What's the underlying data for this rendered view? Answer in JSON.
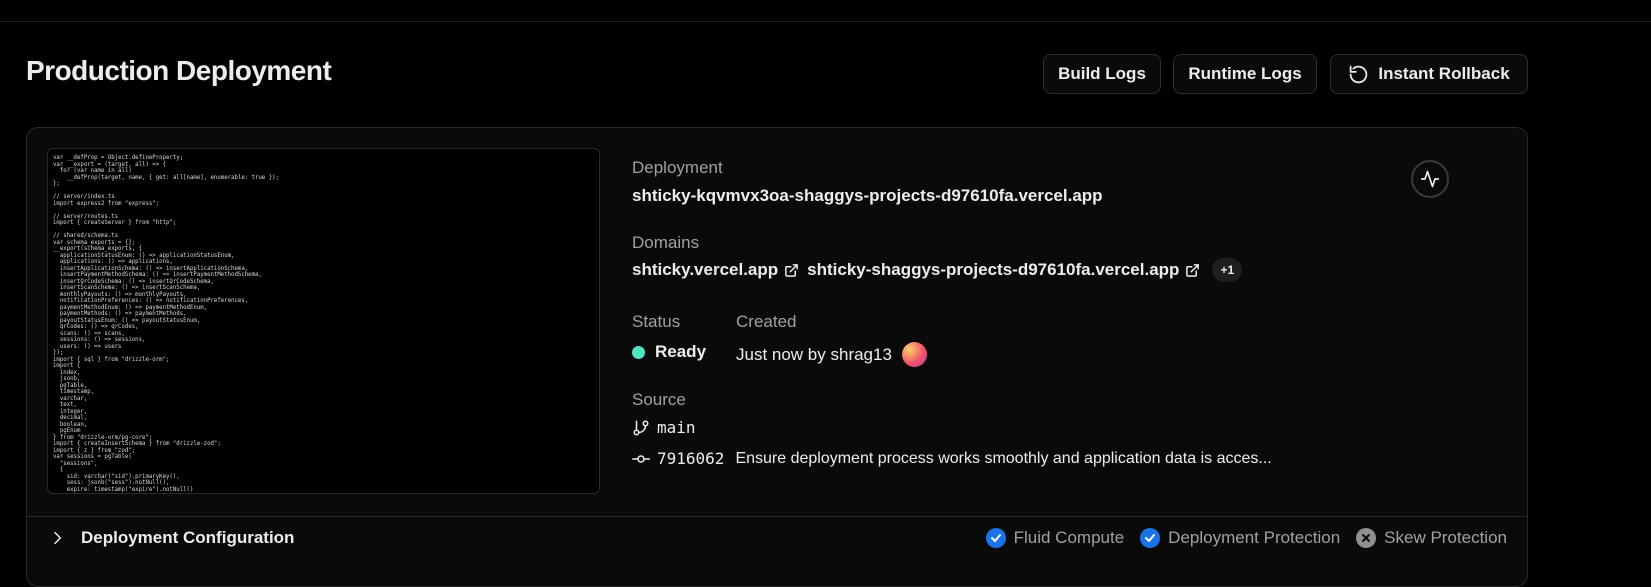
{
  "header": {
    "title": "Production Deployment",
    "buttons": {
      "build_logs": "Build Logs",
      "runtime_logs": "Runtime Logs",
      "instant_rollback": "Instant Rollback"
    }
  },
  "preview": {
    "code": "var __defProp = Object.defineProperty;\nvar __export = (target, all) => {\n  for (var name in all)\n    __defProp(target, name, { get: all[name], enumerable: true });\n};\n\n// server/index.ts\nimport express2 from \"express\";\n\n// server/routes.ts\nimport { createServer } from \"http\";\n\n// shared/schema.ts\nvar schema_exports = {};\n__export(schema_exports, {\n  applicationStatusEnum: () => applicationStatusEnum,\n  applications: () => applications,\n  insertApplicationSchema: () => insertApplicationSchema,\n  insertPaymentMethodSchema: () => insertPaymentMethodSchema,\n  insertQrCodeSchema: () => insertQrCodeSchema,\n  insertScanSchema: () => insertScanSchema,\n  monthlyPayouts: () => monthlyPayouts,\n  notificationPreferences: () => notificationPreferences,\n  paymentMethodEnum: () => paymentMethodEnum,\n  paymentMethods: () => paymentMethods,\n  payoutStatusEnum: () => payoutStatusEnum,\n  qrCodes: () => qrCodes,\n  scans: () => scans,\n  sessions: () => sessions,\n  users: () => users\n});\nimport { sql } from \"drizzle-orm\";\nimport {\n  index,\n  jsonb,\n  pgTable,\n  timestamp,\n  varchar,\n  text,\n  integer,\n  decimal,\n  boolean,\n  pgEnum\n} from \"drizzle-orm/pg-core\";\nimport { createInsertSchema } from \"drizzle-zod\";\nimport { z } from \"zod\";\nvar sessions = pgTable(\n  \"sessions\",\n  {\n    sid: varchar(\"sid\").primaryKey(),\n    sess: jsonb(\"sess\").notNull(),\n    expire: timestamp(\"expire\").notNull()\n  },"
  },
  "deployment": {
    "label": "Deployment",
    "url": "shticky-kqvmvx3oa-shaggys-projects-d97610fa.vercel.app"
  },
  "domains": {
    "label": "Domains",
    "items": [
      "shticky.vercel.app",
      "shticky-shaggys-projects-d97610fa.vercel.app"
    ],
    "more": "+1"
  },
  "status": {
    "label": "Status",
    "value": "Ready",
    "color": "#50e3c2"
  },
  "created": {
    "label": "Created",
    "value": "Just now by shrag13"
  },
  "source": {
    "label": "Source",
    "branch": "main",
    "commit_sha": "7916062",
    "commit_message": "Ensure deployment process works smoothly and application data is acces..."
  },
  "config": {
    "label": "Deployment Configuration",
    "features": [
      {
        "label": "Fluid Compute",
        "enabled": true
      },
      {
        "label": "Deployment Protection",
        "enabled": true
      },
      {
        "label": "Skew Protection",
        "enabled": false
      }
    ]
  },
  "colors": {
    "background": "#000000",
    "card": "#0a0a0a",
    "accent_blue": "#1a73e8",
    "ready_green": "#50e3c2"
  },
  "icons": {
    "rollback": "rotate-ccw-icon",
    "external": "external-link-icon",
    "activity": "activity-icon",
    "branch": "git-branch-icon",
    "commit": "git-commit-icon",
    "chevron": "chevron-right-icon"
  }
}
